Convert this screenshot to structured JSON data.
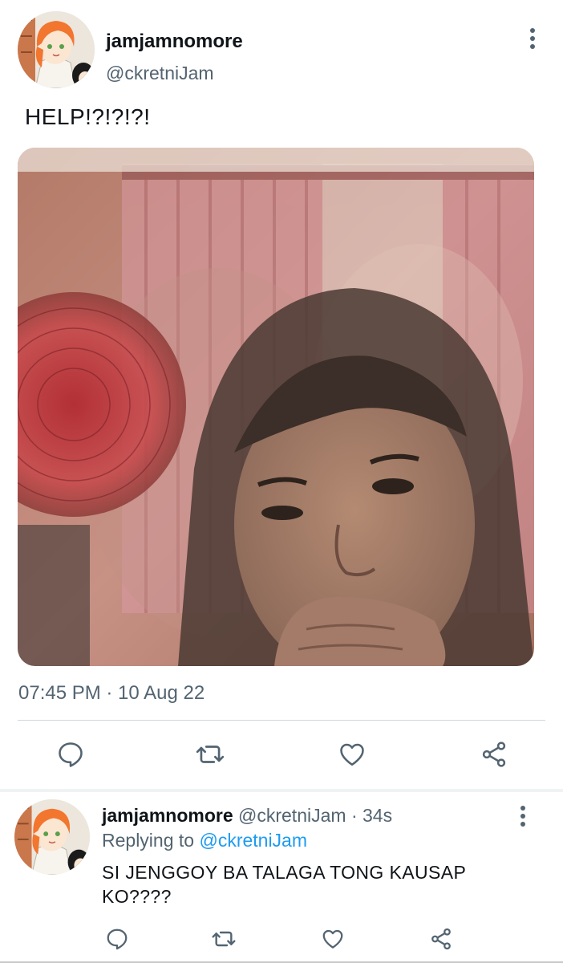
{
  "tweet": {
    "display_name": "jamjamnomore",
    "handle": "@ckretniJam",
    "text": "HELP!?!?!?!",
    "timestamp": "07:45 PM · 10 Aug 22",
    "avatar_icon": "anime-avatar",
    "more_icon": "more-vertical-icon",
    "action_icons": [
      "reply-icon",
      "retweet-icon",
      "like-icon",
      "share-icon"
    ]
  },
  "reply": {
    "display_name": "jamjamnomore",
    "handle": "@ckretniJam",
    "separator": "·",
    "time": "34s",
    "replying_prefix": "Replying to",
    "replying_to": "@ckretniJam",
    "text": "SI JENGGOY BA TALAGA TONG KAUSAP KO????",
    "avatar_icon": "anime-avatar",
    "more_icon": "more-vertical-icon",
    "action_icons": [
      "reply-icon",
      "retweet-icon",
      "like-icon",
      "share-icon"
    ]
  },
  "colors": {
    "primary_text": "#0f1419",
    "secondary_text": "#536471",
    "link": "#1d9bf0",
    "divider": "#cfd9de"
  }
}
